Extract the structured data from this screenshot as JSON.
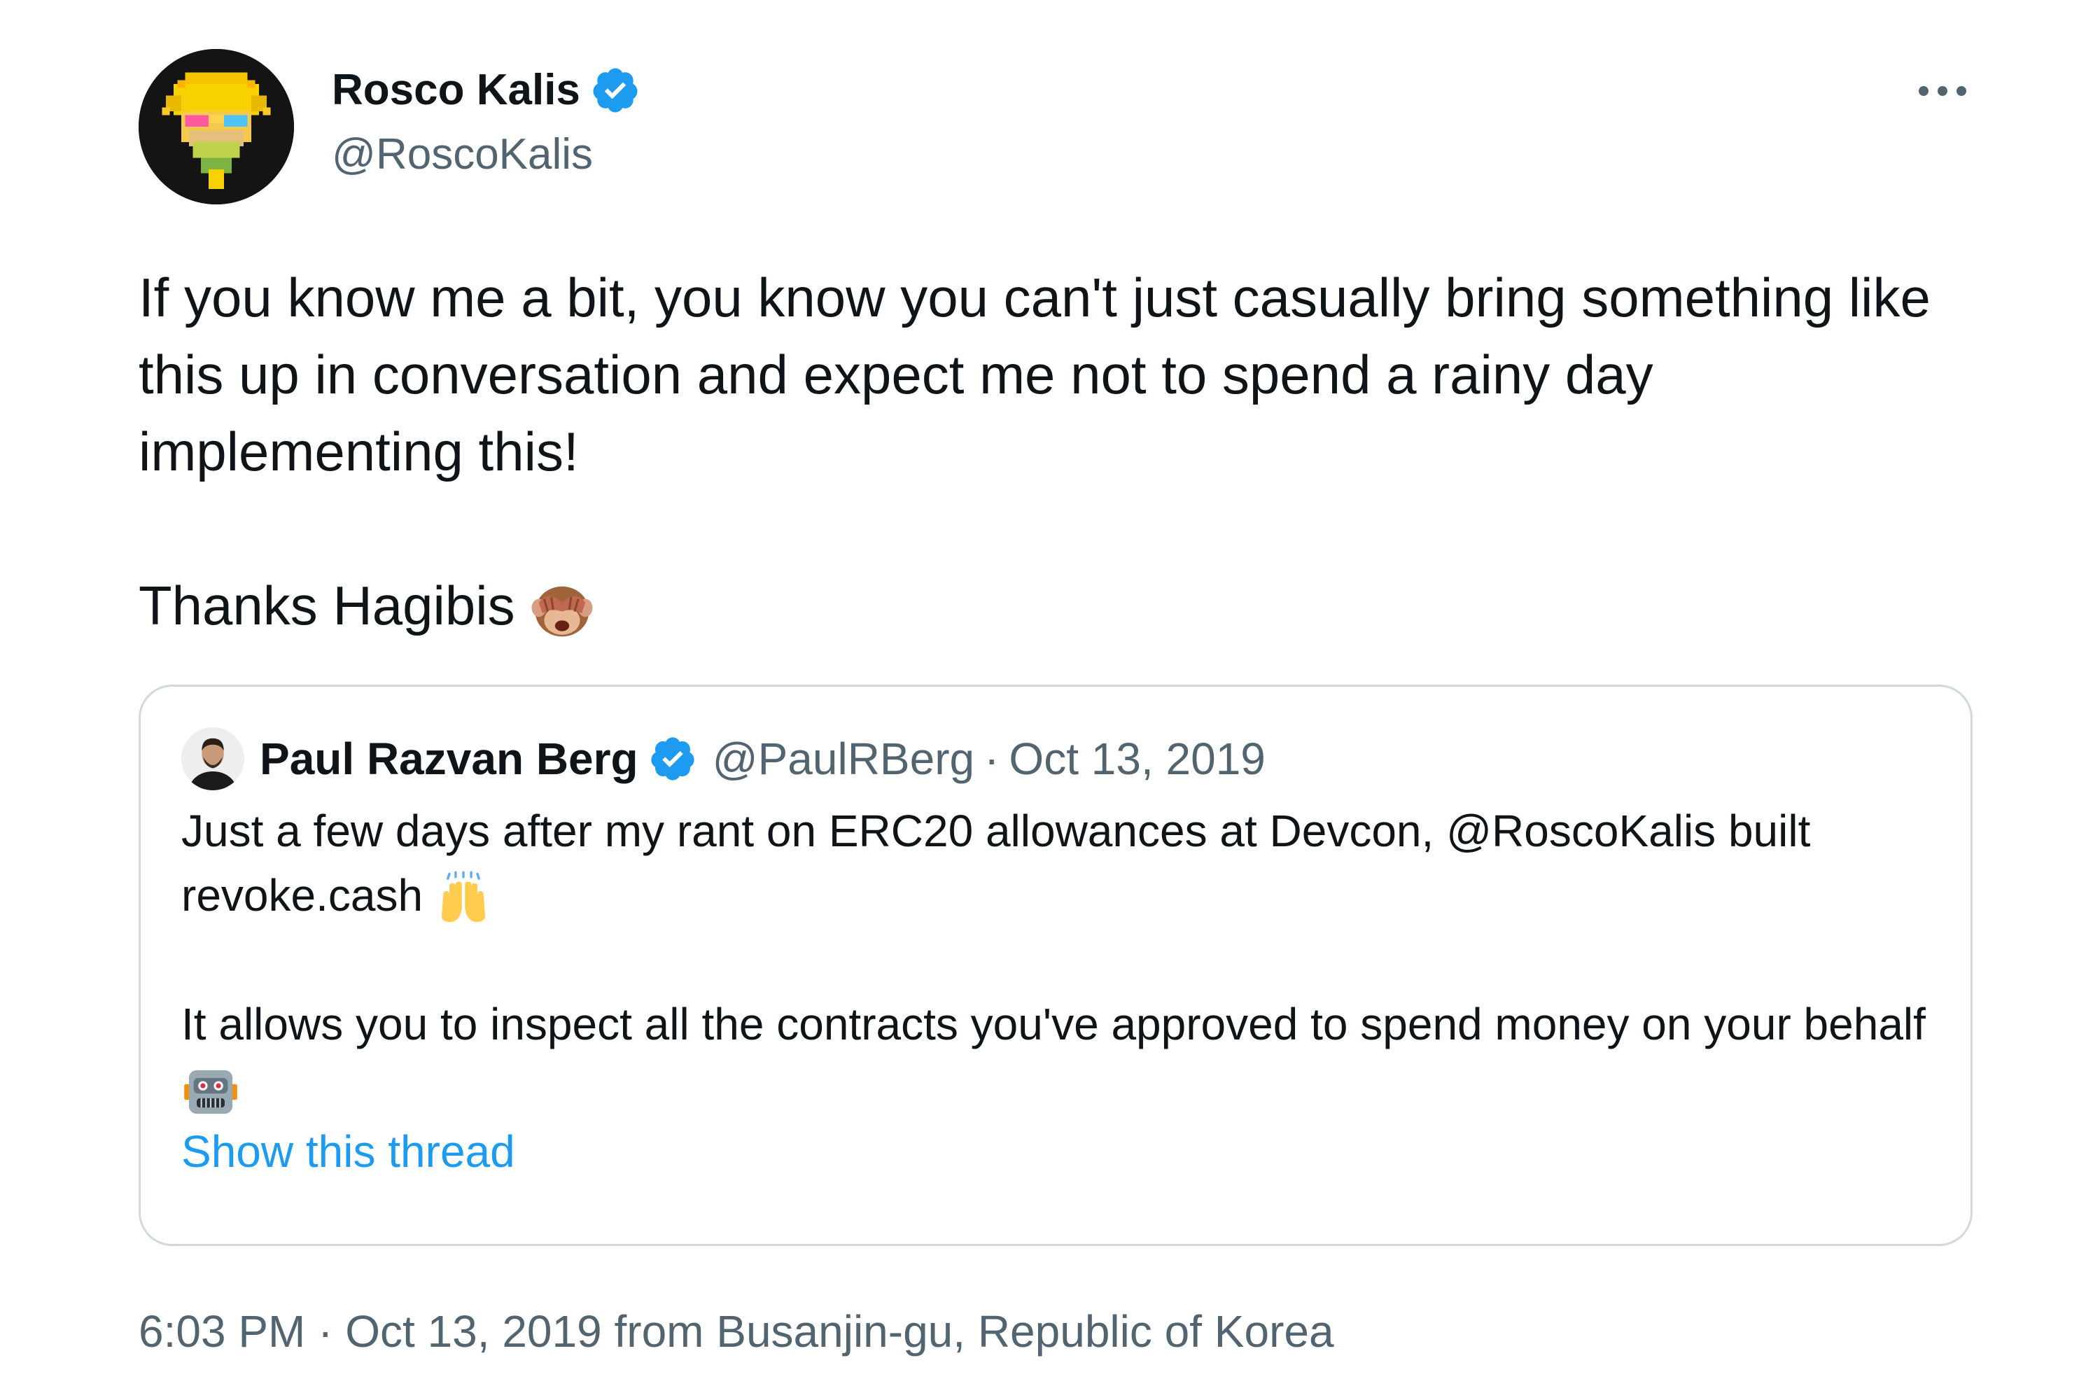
{
  "author": {
    "name": "Rosco Kalis",
    "handle": "@RoscoKalis",
    "verified": true
  },
  "menu": {
    "more_icon": "more-horizontal-icon"
  },
  "tweet": {
    "paragraph_1": "If you know me a bit, you know you can't just casually bring something like this up in conversation and expect me not to spend a rainy day implementing this!",
    "paragraph_2": "Thanks Hagibis",
    "paragraph_2_emoji": "see-no-evil-monkey-emoji"
  },
  "quoted_tweet": {
    "author_name": "Paul Razvan Berg",
    "author_handle": "@PaulRBerg",
    "separator": "·",
    "date": "Oct 13, 2019",
    "verified": true,
    "line_1": "Just a few days after my rant on ERC20 allowances at Devcon, @RoscoKalis built revoke.cash",
    "line_1_emoji": "raising-hands-emoji",
    "line_2": "It allows you to inspect all the contracts you've approved to spend money on your behalf",
    "line_2_emoji": "robot-emoji",
    "show_thread": "Show this thread"
  },
  "meta": {
    "time": "6:03 PM",
    "separator": "·",
    "date": "Oct 13, 2019",
    "location": "from Busanjin-gu, Republic of Korea"
  },
  "colors": {
    "text": "#0f1419",
    "secondary": "#536471",
    "link": "#1d9bf0",
    "verified": "#1d9bf0",
    "border": "#cfd9de"
  }
}
